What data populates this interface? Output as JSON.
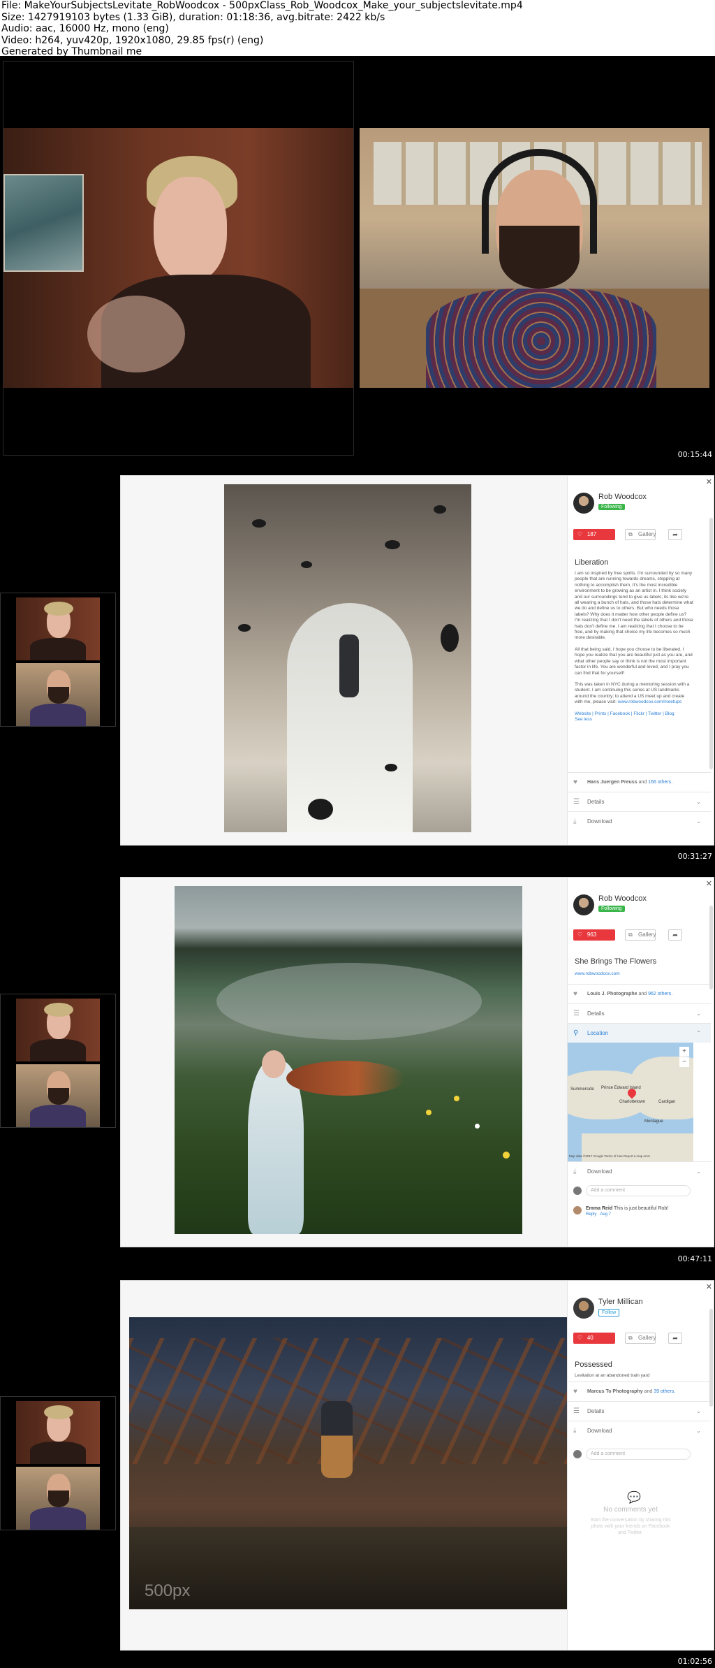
{
  "header": {
    "line1": "File: MakeYourSubjectsLevitate_RobWoodcox - 500pxClass_Rob_Woodcox_Make_your_subjectslevitate.mp4",
    "line2": "Size: 1427919103 bytes (1.33 GiB), duration: 01:18:36, avg.bitrate: 2422 kb/s",
    "line3": "Audio: aac, 16000 Hz, mono (eng)",
    "line4": "Video: h264, yuv420p, 1920x1080, 29.85 fps(r) (eng)",
    "line5": "Generated by Thumbnail me"
  },
  "timestamps": [
    "00:15:44",
    "00:31:27",
    "00:47:11",
    "01:02:56"
  ],
  "frames": [
    {
      "photographer": "Rob Woodcox",
      "follow_label": "Following",
      "likes": "187",
      "gallery_label": "Gallery",
      "share_icon": "share-icon",
      "title": "Liberation",
      "description_p1": "I am so inspired by free spirits. I'm surrounded by so many people that are running towards dreams, stopping at nothing to accomplish them. It's the most incredible environment to be growing as an artist in. I think society and our surroundings tend to give us labels; its like we're all wearing a bunch of hats, and those hats determine what we do and define us to others. But who needs those labels? Why does it matter how other people define us? I'm realizing that I don't need the labels of others and those hats don't define me. I am realizing that I choose to be free, and by making that choice my life becomes so much more desirable.",
      "description_p2": "All that being said, I hope you choose to be liberated. I hope you realize that you are beautiful just as you are, and what other people say or think is not the most important factor in life. You are wonderful and loved, and I pray you can find that for yourself!",
      "description_p3": "This was taken in NYC during a mentoring session with a student. I am continuing this series at US landmarks around the country; to attend a US meet up and create with me, please visit:",
      "description_link": "www.robwoodcox.com/meetups",
      "links": "Website | Prints | Facebook | Flickr | Twitter | Blog",
      "see_less": "See less",
      "liked_by": "Hans Juergen Preuss",
      "liked_others": "166 others.",
      "details_label": "Details",
      "download_label": "Download"
    },
    {
      "photographer": "Rob Woodcox",
      "follow_label": "Following",
      "likes": "963",
      "gallery_label": "Gallery",
      "title": "She Brings The Flowers",
      "subtitle": "www.robwoodcox.com",
      "liked_by": "Louis J. Photographe",
      "liked_others": "962 others.",
      "details_label": "Details",
      "location_label": "Location",
      "map_labels": [
        "Prince Edward Island",
        "Charlottetown",
        "Summerside",
        "Cardigan",
        "Montague"
      ],
      "map_footer": "Map data ©2017 Google   Terms of Use   Report a map error",
      "download_label": "Download",
      "comment_placeholder": "Add a comment",
      "commenter": "Emma Reid",
      "comment_text": "This is just beautiful Rob!",
      "comment_reply": "Reply · Aug 7"
    },
    {
      "photographer": "Tyler Millican",
      "follow_label": "Follow",
      "likes": "40",
      "gallery_label": "Gallery",
      "title": "Possessed",
      "subtitle": "Levitation at an abandoned train yard",
      "liked_by": "Marcus To Photography",
      "liked_others": "39 others.",
      "details_label": "Details",
      "download_label": "Download",
      "comment_placeholder": "Add a comment",
      "no_comments_title": "No comments yet",
      "no_comments_text": "Start the conversation by sharing this photo with your friends on Facebook and Twitter.",
      "watermark": "500px"
    }
  ],
  "colors": {
    "like_red": "#e8383d",
    "follow_green": "#39b54a",
    "link_blue": "#2a7fd6"
  }
}
